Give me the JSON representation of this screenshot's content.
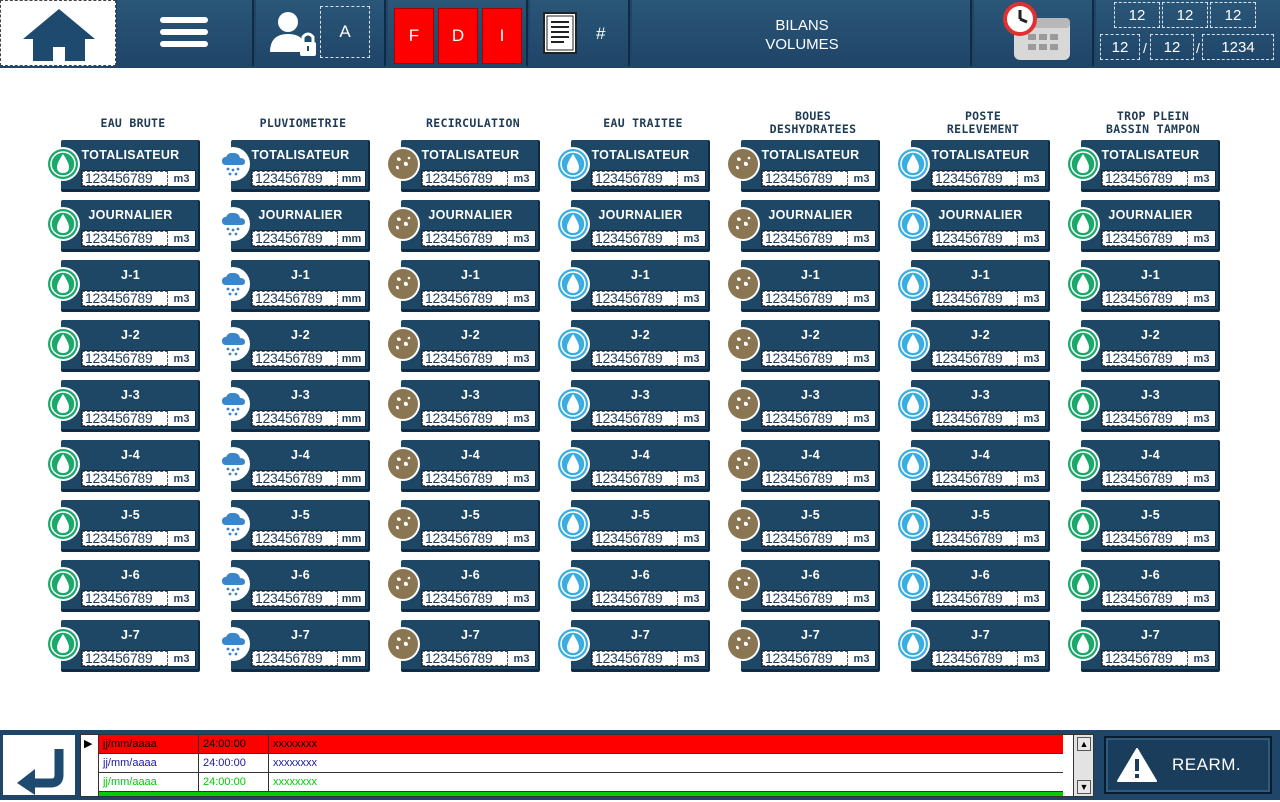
{
  "header": {
    "user_access_level": "A",
    "fdi_buttons": [
      "F",
      "D",
      "I"
    ],
    "doc_number": "#",
    "title_line1": "BILANS",
    "title_line2": "VOLUMES",
    "date_top": [
      "12",
      "12",
      "12"
    ],
    "date_bottom": [
      "12",
      "12",
      "1234"
    ],
    "date_sep": "/"
  },
  "colors": {
    "header_bg": "#1f4568",
    "card_bg": "#1e4766",
    "alarm_red": "#ff0000",
    "alarm_green": "#00cc00",
    "fdi_red": "#ff0000",
    "icon_green": "#1aa86b",
    "icon_brown": "#8b7653",
    "icon_lightblue": "#3aaee0",
    "icon_cloud": "#3a86c8"
  },
  "grid": {
    "columns": [
      {
        "title_line1": "EAU BRUTE",
        "title_line2": "",
        "icon": "water-drop-green",
        "unit": "m3"
      },
      {
        "title_line1": "PLUVIOMETRIE",
        "title_line2": "",
        "icon": "rain-cloud",
        "unit": "mm"
      },
      {
        "title_line1": "RECIRCULATION",
        "title_line2": "",
        "icon": "sludge-brown",
        "unit": "m3"
      },
      {
        "title_line1": "EAU TRAITEE",
        "title_line2": "",
        "icon": "water-drop-lightblue",
        "unit": "m3"
      },
      {
        "title_line1": "BOUES",
        "title_line2": "DESHYDRATEES",
        "icon": "sludge-brown",
        "unit": "m3"
      },
      {
        "title_line1": "POSTE",
        "title_line2": "RELEVEMENT",
        "icon": "water-drop-lightblue",
        "unit": "m3"
      },
      {
        "title_line1": "TROP PLEIN",
        "title_line2": "BASSIN TAMPON",
        "icon": "water-drop-green",
        "unit": "m3"
      }
    ],
    "rows": [
      "TOTALISATEUR",
      "JOURNALIER",
      "J-1",
      "J-2",
      "J-3",
      "J-4",
      "J-5",
      "J-6",
      "J-7"
    ],
    "value": "123456789"
  },
  "alarms": {
    "rows": [
      {
        "date": "jj/mm/aaaa",
        "time": "24:00:00",
        "message": "xxxxxxxx",
        "style": "red"
      },
      {
        "date": "jj/mm/aaaa",
        "time": "24:00:00",
        "message": "xxxxxxxx",
        "style": "white-blue"
      },
      {
        "date": "jj/mm/aaaa",
        "time": "24:00:00",
        "message": "xxxxxxxx",
        "style": "white-green"
      }
    ],
    "scroll_up": "▲",
    "scroll_down": "▼",
    "marker": "▶"
  },
  "footer": {
    "rearm_label": "REARM."
  }
}
